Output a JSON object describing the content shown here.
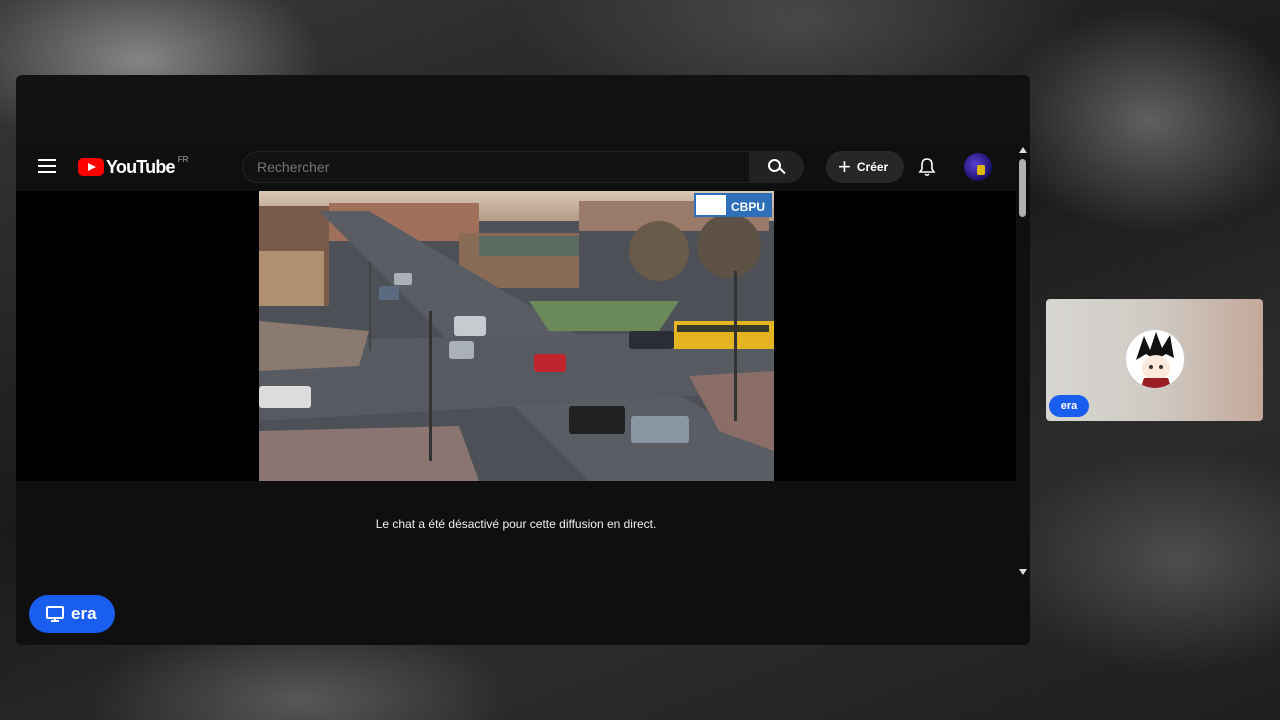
{
  "meeting": {
    "presenter_label": "era",
    "participant_name": "era"
  },
  "youtube": {
    "logo_text": "YouTube",
    "logo_region": "FR",
    "search_placeholder": "Rechercher",
    "create_label": "Créer",
    "chat_notice": "Le chat a été désactivé pour cette diffusion en direct.",
    "video_watermark": "CBPU"
  },
  "icons": {
    "menu": "menu-icon",
    "search": "search-icon",
    "create": "plus-icon",
    "notifications": "bell-icon",
    "presenting": "monitor-icon"
  },
  "colors": {
    "accent_blue": "#1a5ef0",
    "youtube_red": "#ff0000"
  }
}
